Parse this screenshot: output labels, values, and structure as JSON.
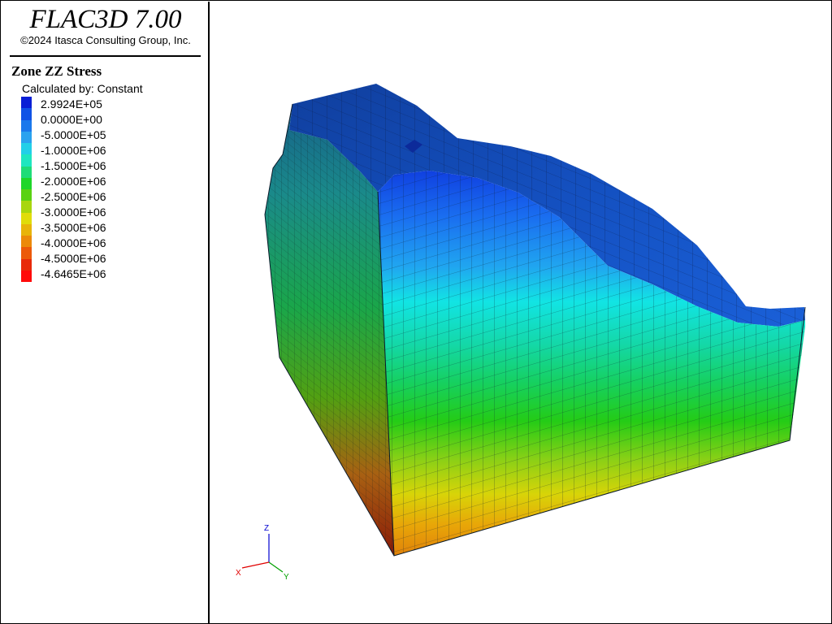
{
  "app": {
    "title": "FLAC3D 7.00",
    "copyright": "©2024 Itasca Consulting Group, Inc."
  },
  "legend": {
    "title": "Zone ZZ Stress",
    "subtitle": "Calculated by: Constant",
    "colors": [
      "#0a1fd6",
      "#1052e6",
      "#1a78ec",
      "#2aa2ef",
      "#22cfe8",
      "#1ee6c0",
      "#1edc78",
      "#1ed62a",
      "#5ad212",
      "#a8d60e",
      "#e0dc0a",
      "#e8b40a",
      "#ec8a0a",
      "#ec5a0a",
      "#e82a0a",
      "#ff0a0a"
    ],
    "labels": [
      "2.9924E+05",
      "0.0000E+00",
      "-5.0000E+05",
      "-1.0000E+06",
      "-1.5000E+06",
      "-2.0000E+06",
      "-2.5000E+06",
      "-3.0000E+06",
      "-3.5000E+06",
      "-4.0000E+06",
      "-4.5000E+06",
      "-4.6465E+06"
    ]
  },
  "axes": {
    "x_label": "X",
    "y_label": "Y",
    "z_label": "Z",
    "x_color": "#e00000",
    "y_color": "#00a000",
    "z_color": "#0000d0"
  }
}
